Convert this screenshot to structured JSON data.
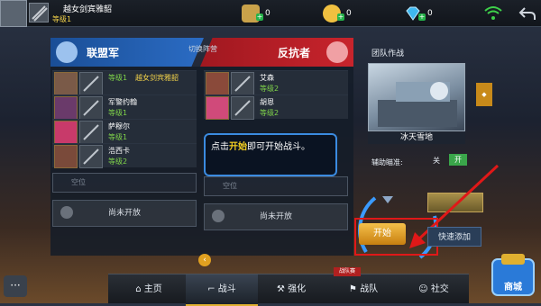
{
  "topbar": {
    "username": "越女剑宾雅韶",
    "level": "等级1",
    "currencies": [
      {
        "name": "gem-token",
        "value": "0",
        "color": "#c9a24a"
      },
      {
        "name": "coin",
        "value": "0",
        "color": "#f0c040"
      },
      {
        "name": "diamond",
        "value": "0",
        "color": "#3fb8f0"
      }
    ]
  },
  "blue_team": {
    "title": "联盟军",
    "members": [
      {
        "name": "越女剑宾雅韶",
        "level": "等级1",
        "is_self": true
      },
      {
        "name": "军警约翰",
        "level": "等级1"
      },
      {
        "name": "萨穆尔",
        "level": "等级1"
      },
      {
        "name": "浩西卡",
        "level": "等级2"
      }
    ],
    "empty_label": "空位",
    "closed_label": "尚未开放"
  },
  "switch_label": "切换阵营",
  "red_team": {
    "title": "反抗者",
    "members": [
      {
        "name": "艾森",
        "level": "等级2"
      },
      {
        "name": "胡恩",
        "level": "等级2"
      }
    ],
    "empty_label": "空位",
    "closed_label": "尚未开放"
  },
  "tooltip": {
    "pre": "点击",
    "highlight": "开始",
    "post": "即可开始战斗。"
  },
  "mode": {
    "title": "团队作战",
    "map_name": "冰天雪地",
    "aim_label": "辅助瞄准:",
    "aim_off": "关",
    "aim_on": "开",
    "start_label": "开始",
    "quick_add_label": "快速添加"
  },
  "nav": {
    "items": [
      {
        "label": "主页",
        "icon": "home-icon"
      },
      {
        "label": "战斗",
        "icon": "gun-icon"
      },
      {
        "label": "强化",
        "icon": "wrench-icon"
      },
      {
        "label": "战队",
        "icon": "flag-icon"
      },
      {
        "label": "社交",
        "icon": "people-icon"
      }
    ],
    "badge": "战队赛",
    "mall_label": "商城"
  },
  "colors": {
    "blue": "#2b6cc4",
    "red": "#c8242c",
    "level_green": "#7fd34a",
    "accent_gold": "#e0b030",
    "highlight_yellow": "#f5d020"
  }
}
